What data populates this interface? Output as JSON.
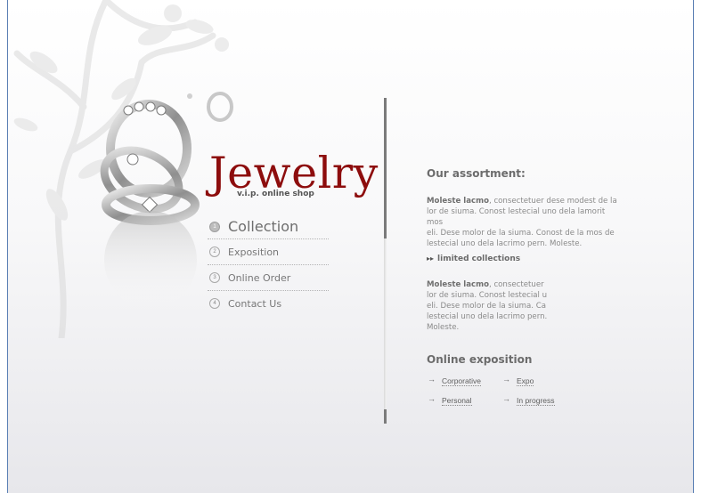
{
  "brand": {
    "title": "Jewelry",
    "subtitle": "v.i.p. online shop"
  },
  "nav": {
    "items": [
      {
        "num": "1",
        "label": "Collection"
      },
      {
        "num": "2",
        "label": "Exposition"
      },
      {
        "num": "3",
        "label": "Online Order"
      },
      {
        "num": "4",
        "label": "Contact Us"
      }
    ]
  },
  "assortment": {
    "heading": "Our assortment:",
    "para1_bold": "Moleste lacmo",
    "para1_lines": [
      ", consectetuer dese modest de la",
      "lor de siuma. Conost lestecial uno dela lamorit mos",
      "eli. Dese molor de la siuma. Conost de la mos de",
      "lestecial uno dela lacrimo pern. Moleste."
    ],
    "limited_label": "limited collections",
    "para2_bold": "Moleste lacmo",
    "para2_lines": [
      ", consectetuer",
      "lor de siuma. Conost lestecial u",
      "eli. Dese molor de la siuma. Ca",
      "lestecial uno dela lacrimo pern.",
      "Moleste."
    ]
  },
  "exposition": {
    "heading": "Online exposition",
    "links": [
      "Corporative",
      "Expo",
      "Personal",
      "In progress"
    ]
  },
  "colors": {
    "brand_red": "#8d0d0d",
    "frame_border": "#5a7fb4"
  }
}
